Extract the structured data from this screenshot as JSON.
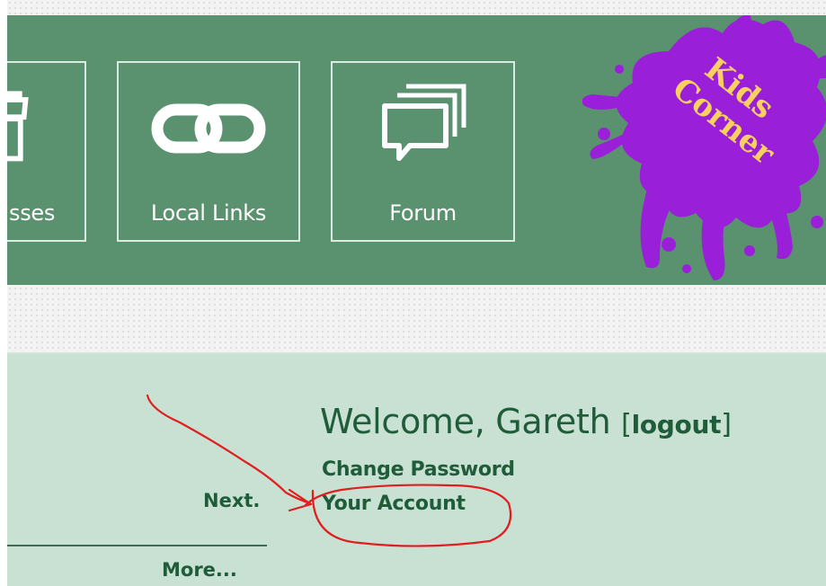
{
  "banner": {
    "tiles": [
      {
        "label": "sses",
        "icon": "shop-icon"
      },
      {
        "label": "Local Links",
        "icon": "link-icon"
      },
      {
        "label": "Forum",
        "icon": "chat-bubbles-icon"
      }
    ],
    "kids_corner": {
      "line1": "Kids",
      "line2": "Corner",
      "splat_color": "#9a1fd8",
      "text_color": "#f7d060"
    }
  },
  "account": {
    "welcome": "Welcome, Gareth",
    "bracket_open": "[",
    "logout": "logout",
    "bracket_close": "]",
    "change_password": "Change Password",
    "your_account": "Your Account"
  },
  "nav": {
    "next": "Next.",
    "more": "More..."
  },
  "colors": {
    "banner": "#5a9270",
    "content": "#c8e1d3",
    "text": "#1e5c3a",
    "annotation": "#e01e1e"
  }
}
